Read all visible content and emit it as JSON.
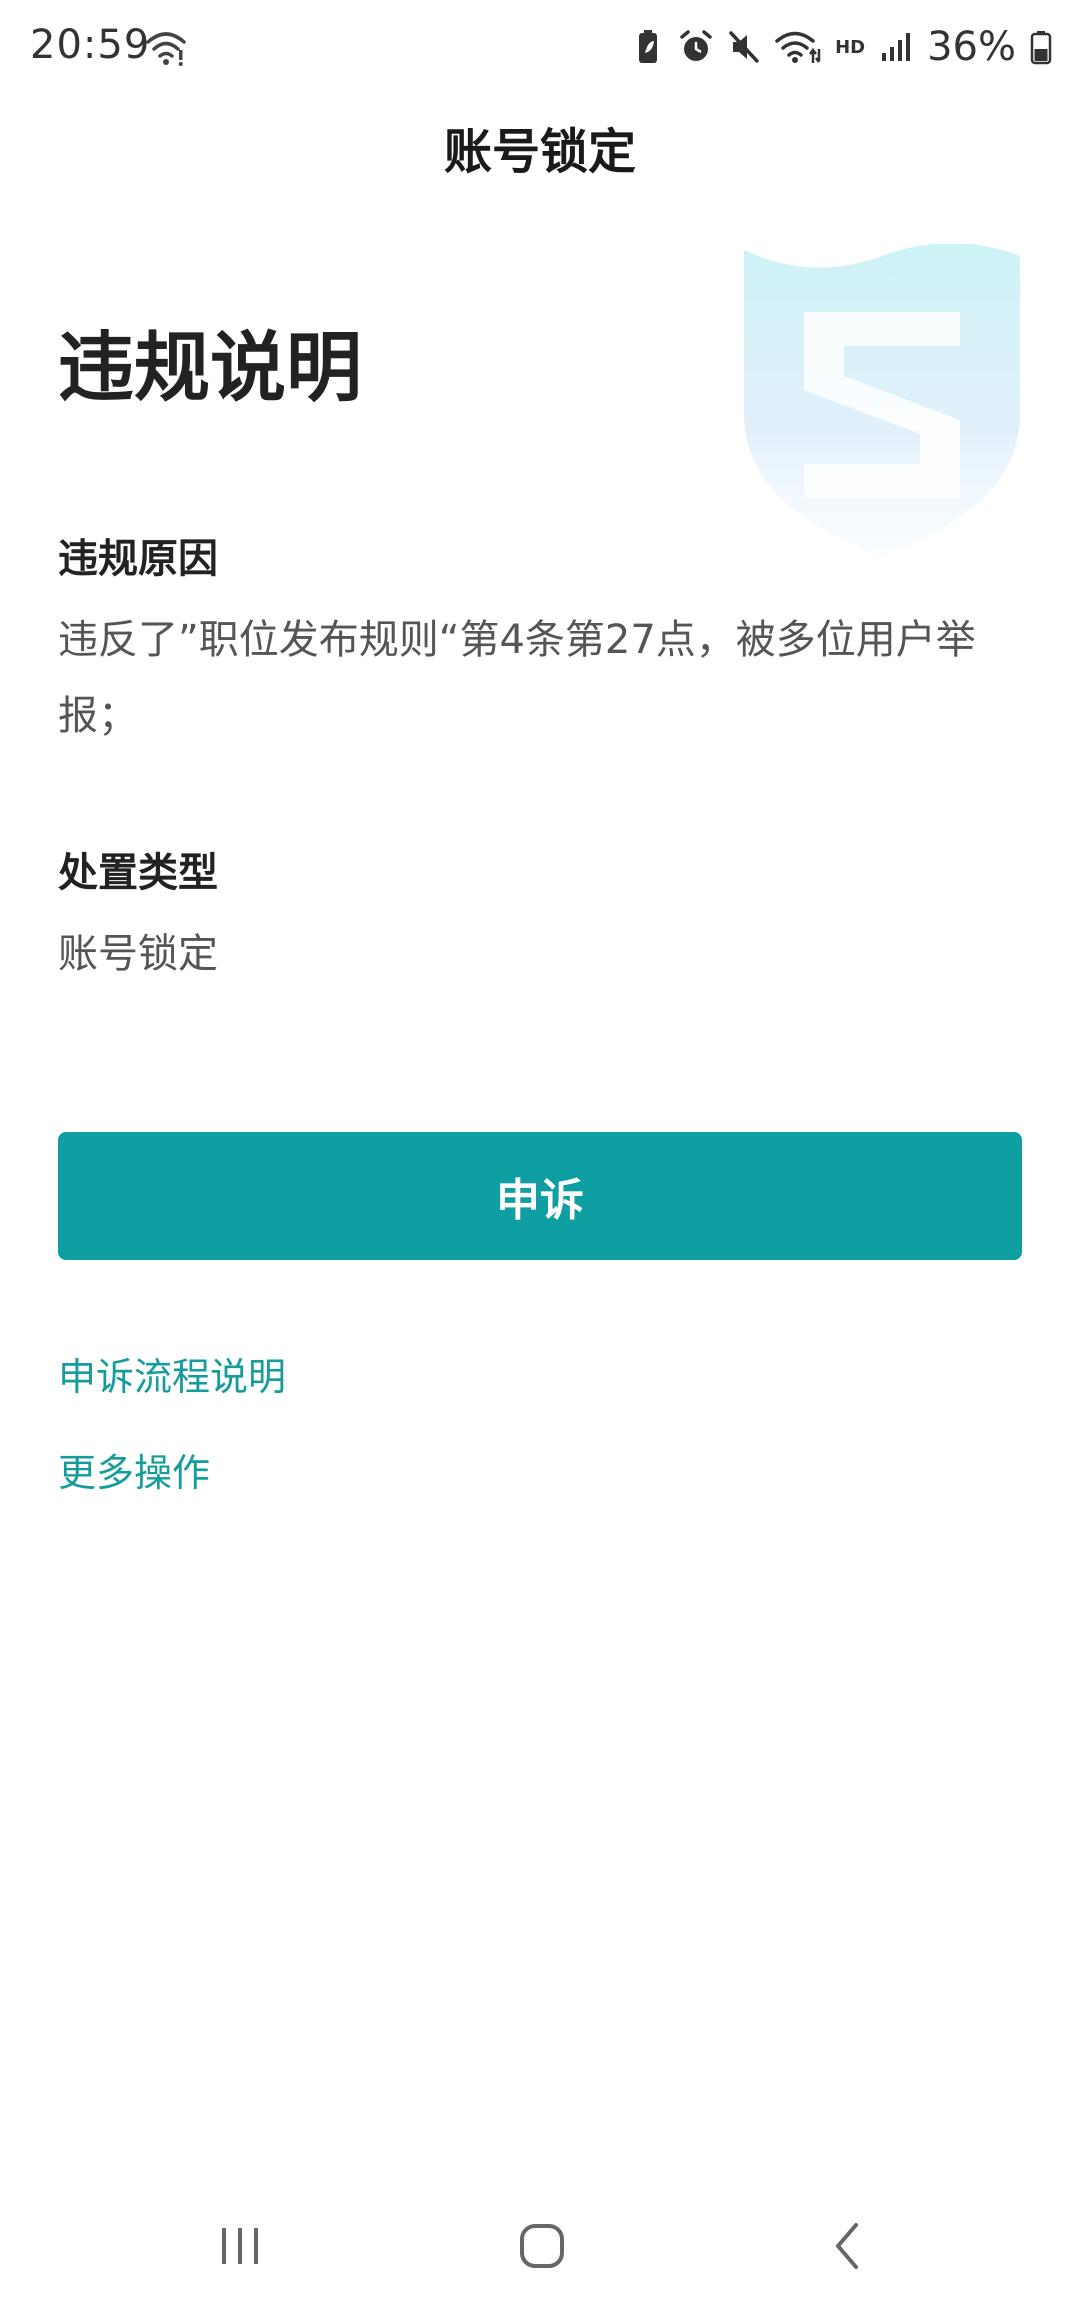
{
  "status_bar": {
    "time": "20:59",
    "hd_label": "HD",
    "battery_percent": "36%",
    "icons": [
      "wifi-icon",
      "battery-saver-icon",
      "alarm-icon",
      "mute-icon",
      "wifi-data-icon",
      "signal-icon",
      "battery-icon"
    ]
  },
  "header": {
    "title": "账号锁定"
  },
  "main": {
    "heading": "违规说明",
    "reason_label": "违规原因",
    "reason_text": "违反了”职位发布规则“第4条第27点，被多位用户举报；",
    "type_label": "处置类型",
    "type_text": "账号锁定"
  },
  "actions": {
    "appeal_button": "申诉",
    "process_link": "申诉流程说明",
    "more_link": "更多操作"
  },
  "colors": {
    "accent": "#0f9ea2",
    "link": "#179c9c",
    "heading": "#222222",
    "body_text": "#555555"
  }
}
